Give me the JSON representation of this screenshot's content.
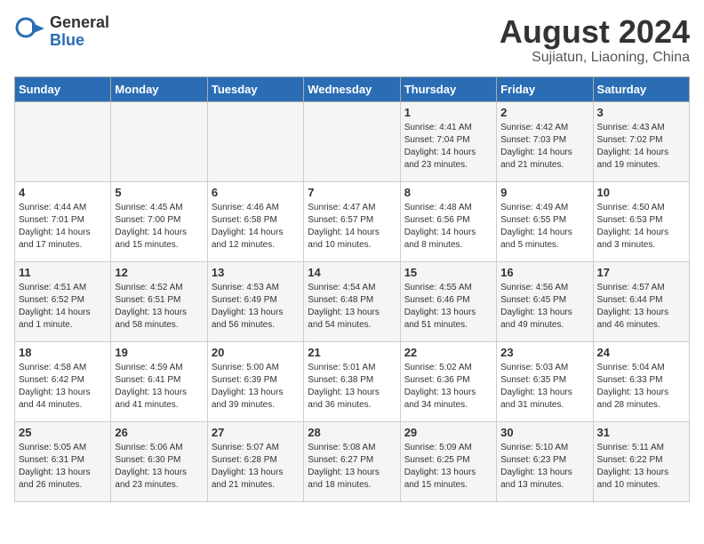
{
  "header": {
    "logo_general": "General",
    "logo_blue": "Blue",
    "month_year": "August 2024",
    "location": "Sujiatun, Liaoning, China"
  },
  "days_of_week": [
    "Sunday",
    "Monday",
    "Tuesday",
    "Wednesday",
    "Thursday",
    "Friday",
    "Saturday"
  ],
  "weeks": [
    [
      {
        "day": "",
        "info": ""
      },
      {
        "day": "",
        "info": ""
      },
      {
        "day": "",
        "info": ""
      },
      {
        "day": "",
        "info": ""
      },
      {
        "day": "1",
        "info": "Sunrise: 4:41 AM\nSunset: 7:04 PM\nDaylight: 14 hours\nand 23 minutes."
      },
      {
        "day": "2",
        "info": "Sunrise: 4:42 AM\nSunset: 7:03 PM\nDaylight: 14 hours\nand 21 minutes."
      },
      {
        "day": "3",
        "info": "Sunrise: 4:43 AM\nSunset: 7:02 PM\nDaylight: 14 hours\nand 19 minutes."
      }
    ],
    [
      {
        "day": "4",
        "info": "Sunrise: 4:44 AM\nSunset: 7:01 PM\nDaylight: 14 hours\nand 17 minutes."
      },
      {
        "day": "5",
        "info": "Sunrise: 4:45 AM\nSunset: 7:00 PM\nDaylight: 14 hours\nand 15 minutes."
      },
      {
        "day": "6",
        "info": "Sunrise: 4:46 AM\nSunset: 6:58 PM\nDaylight: 14 hours\nand 12 minutes."
      },
      {
        "day": "7",
        "info": "Sunrise: 4:47 AM\nSunset: 6:57 PM\nDaylight: 14 hours\nand 10 minutes."
      },
      {
        "day": "8",
        "info": "Sunrise: 4:48 AM\nSunset: 6:56 PM\nDaylight: 14 hours\nand 8 minutes."
      },
      {
        "day": "9",
        "info": "Sunrise: 4:49 AM\nSunset: 6:55 PM\nDaylight: 14 hours\nand 5 minutes."
      },
      {
        "day": "10",
        "info": "Sunrise: 4:50 AM\nSunset: 6:53 PM\nDaylight: 14 hours\nand 3 minutes."
      }
    ],
    [
      {
        "day": "11",
        "info": "Sunrise: 4:51 AM\nSunset: 6:52 PM\nDaylight: 14 hours\nand 1 minute."
      },
      {
        "day": "12",
        "info": "Sunrise: 4:52 AM\nSunset: 6:51 PM\nDaylight: 13 hours\nand 58 minutes."
      },
      {
        "day": "13",
        "info": "Sunrise: 4:53 AM\nSunset: 6:49 PM\nDaylight: 13 hours\nand 56 minutes."
      },
      {
        "day": "14",
        "info": "Sunrise: 4:54 AM\nSunset: 6:48 PM\nDaylight: 13 hours\nand 54 minutes."
      },
      {
        "day": "15",
        "info": "Sunrise: 4:55 AM\nSunset: 6:46 PM\nDaylight: 13 hours\nand 51 minutes."
      },
      {
        "day": "16",
        "info": "Sunrise: 4:56 AM\nSunset: 6:45 PM\nDaylight: 13 hours\nand 49 minutes."
      },
      {
        "day": "17",
        "info": "Sunrise: 4:57 AM\nSunset: 6:44 PM\nDaylight: 13 hours\nand 46 minutes."
      }
    ],
    [
      {
        "day": "18",
        "info": "Sunrise: 4:58 AM\nSunset: 6:42 PM\nDaylight: 13 hours\nand 44 minutes."
      },
      {
        "day": "19",
        "info": "Sunrise: 4:59 AM\nSunset: 6:41 PM\nDaylight: 13 hours\nand 41 minutes."
      },
      {
        "day": "20",
        "info": "Sunrise: 5:00 AM\nSunset: 6:39 PM\nDaylight: 13 hours\nand 39 minutes."
      },
      {
        "day": "21",
        "info": "Sunrise: 5:01 AM\nSunset: 6:38 PM\nDaylight: 13 hours\nand 36 minutes."
      },
      {
        "day": "22",
        "info": "Sunrise: 5:02 AM\nSunset: 6:36 PM\nDaylight: 13 hours\nand 34 minutes."
      },
      {
        "day": "23",
        "info": "Sunrise: 5:03 AM\nSunset: 6:35 PM\nDaylight: 13 hours\nand 31 minutes."
      },
      {
        "day": "24",
        "info": "Sunrise: 5:04 AM\nSunset: 6:33 PM\nDaylight: 13 hours\nand 28 minutes."
      }
    ],
    [
      {
        "day": "25",
        "info": "Sunrise: 5:05 AM\nSunset: 6:31 PM\nDaylight: 13 hours\nand 26 minutes."
      },
      {
        "day": "26",
        "info": "Sunrise: 5:06 AM\nSunset: 6:30 PM\nDaylight: 13 hours\nand 23 minutes."
      },
      {
        "day": "27",
        "info": "Sunrise: 5:07 AM\nSunset: 6:28 PM\nDaylight: 13 hours\nand 21 minutes."
      },
      {
        "day": "28",
        "info": "Sunrise: 5:08 AM\nSunset: 6:27 PM\nDaylight: 13 hours\nand 18 minutes."
      },
      {
        "day": "29",
        "info": "Sunrise: 5:09 AM\nSunset: 6:25 PM\nDaylight: 13 hours\nand 15 minutes."
      },
      {
        "day": "30",
        "info": "Sunrise: 5:10 AM\nSunset: 6:23 PM\nDaylight: 13 hours\nand 13 minutes."
      },
      {
        "day": "31",
        "info": "Sunrise: 5:11 AM\nSunset: 6:22 PM\nDaylight: 13 hours\nand 10 minutes."
      }
    ]
  ]
}
